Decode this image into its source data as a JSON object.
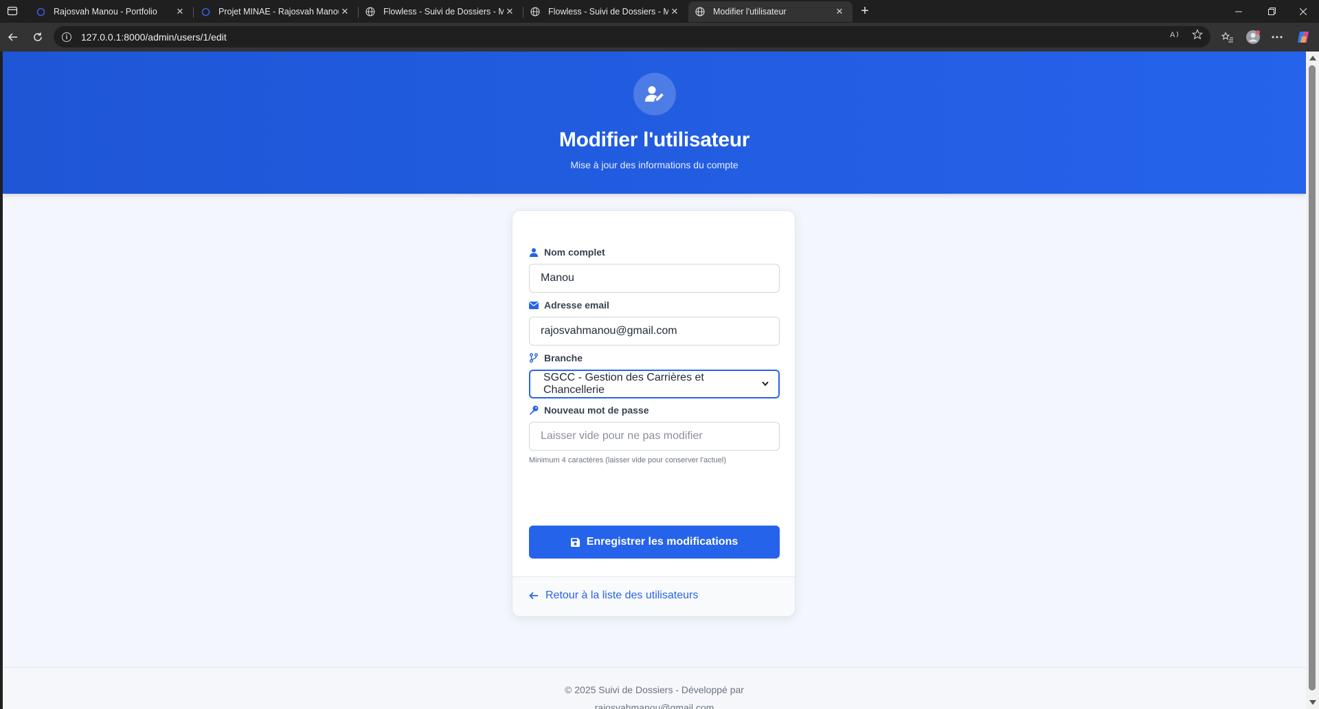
{
  "browser": {
    "tabs": [
      {
        "title": "Rajosvah Manou - Portfolio",
        "icon": "circle-favicon-icon"
      },
      {
        "title": "Projet MINAE - Rajosvah Manou",
        "icon": "circle-favicon-icon"
      },
      {
        "title": "Flowless - Suivi de Dossiers - MINAE",
        "icon": "globe-icon"
      },
      {
        "title": "Flowless - Suivi de Dossiers - MINAE",
        "icon": "globe-icon"
      },
      {
        "title": "Modifier l'utilisateur",
        "icon": "globe-icon",
        "active": true
      }
    ],
    "url": "127.0.0.1:8000/admin/users/1/edit"
  },
  "header": {
    "icon": "user-edit-icon",
    "title": "Modifier l'utilisateur",
    "subtitle": "Mise à jour des informations du compte"
  },
  "form": {
    "name": {
      "label": "Nom complet",
      "value": "Manou",
      "icon": "user-icon"
    },
    "email": {
      "label": "Adresse email",
      "value": "rajosvahmanou@gmail.com",
      "icon": "envelope-icon"
    },
    "branch": {
      "label": "Branche",
      "selected": "SGCC - Gestion des Carrières et Chancellerie",
      "icon": "code-branch-icon"
    },
    "password": {
      "label": "Nouveau mot de passe",
      "placeholder": "Laisser vide pour ne pas modifier",
      "hint": "Minimum 4 caractères (laisser vide pour conserver l'actuel)",
      "icon": "key-icon"
    },
    "submit_label": "Enregistrer les modifications"
  },
  "back_link": "Retour à la liste des utilisateurs",
  "footer": {
    "line1": "© 2025 Suivi de Dossiers - Développé par",
    "line2": "rajosvahmanou@gmail.com"
  },
  "colors": {
    "primary": "#2563eb",
    "background": "#f3f6fc",
    "chrome": "#1f1f1f"
  }
}
